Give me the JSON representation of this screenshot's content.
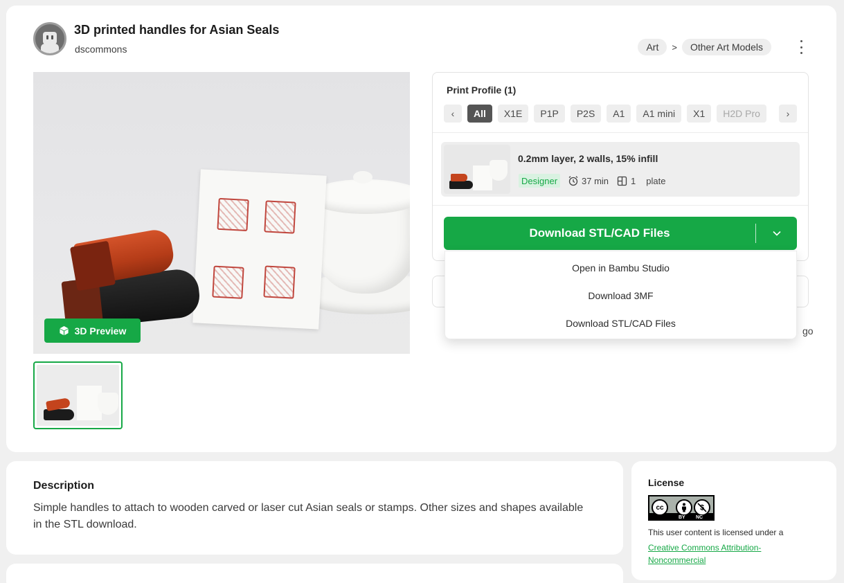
{
  "header": {
    "title": "3D printed handles for Asian Seals",
    "author": "dscommons",
    "breadcrumb": [
      "Art",
      "Other Art Models"
    ],
    "breadcrumb_separator": ">"
  },
  "gallery": {
    "preview_button": "3D Preview"
  },
  "print_profile": {
    "label": "Print Profile (1)",
    "chips": [
      "All",
      "X1E",
      "P1P",
      "P2S",
      "A1",
      "A1 mini",
      "X1",
      "H2D Pro"
    ],
    "active_chip": "All",
    "item": {
      "name": "0.2mm layer, 2 walls, 15% infill",
      "badge": "Designer",
      "time": "37 min",
      "plates": "1",
      "plates_unit": "plate"
    }
  },
  "download": {
    "label": "Download STL/CAD Files",
    "menu": [
      "Open in Bambu Studio",
      "Download 3MF",
      "Download STL/CAD Files"
    ]
  },
  "behind_text": "go",
  "description": {
    "title": "Description",
    "text": "Simple handles to attach to wooden carved or laser cut Asian seals or stamps. Other sizes and shapes available in the STL download."
  },
  "license": {
    "title": "License",
    "badge_labels": [
      "BY",
      "NC"
    ],
    "text": "This user content is licensed under a",
    "link": "Creative Commons Attribution-Noncommercial"
  },
  "colors": {
    "accent": "#16a846"
  }
}
